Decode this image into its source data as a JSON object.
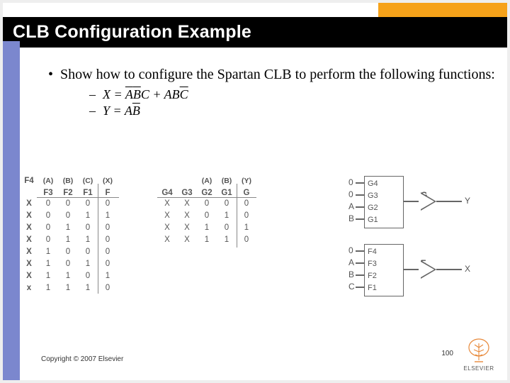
{
  "title": "CLB Configuration Example",
  "bullet_text": "Show how to configure the Spartan CLB to perform the following functions:",
  "equations": {
    "x_lhs": "X",
    "x_eq": " = ",
    "x_t1a": "A",
    "x_t1b": "B",
    "x_t1c": "C",
    "x_plus": " + ",
    "x_t2a": "A",
    "x_t2b": "B",
    "x_t2c": "C",
    "y_lhs": "Y",
    "y_eq": " = ",
    "y_a": "A",
    "y_b": "B"
  },
  "tableF": {
    "name": "F4",
    "paren": [
      "(A)",
      "(B)",
      "(C)",
      "(X)"
    ],
    "cols": [
      "F3",
      "F2",
      "F1",
      "F"
    ],
    "rows": [
      [
        "X",
        "0",
        "0",
        "0",
        "0"
      ],
      [
        "X",
        "0",
        "0",
        "1",
        "1"
      ],
      [
        "X",
        "0",
        "1",
        "0",
        "0"
      ],
      [
        "X",
        "0",
        "1",
        "1",
        "0"
      ],
      [
        "X",
        "1",
        "0",
        "0",
        "0"
      ],
      [
        "X",
        "1",
        "0",
        "1",
        "0"
      ],
      [
        "X",
        "1",
        "1",
        "0",
        "1"
      ],
      [
        "x",
        "1",
        "1",
        "1",
        "0"
      ]
    ]
  },
  "tableG": {
    "paren": [
      "(A)",
      "(B)",
      "(Y)"
    ],
    "cols": [
      "G4",
      "G3",
      "G2",
      "G1",
      "G"
    ],
    "rows": [
      [
        "X",
        "X",
        "0",
        "0",
        "0"
      ],
      [
        "X",
        "X",
        "0",
        "1",
        "0"
      ],
      [
        "X",
        "X",
        "1",
        "0",
        "1"
      ],
      [
        "X",
        "X",
        "1",
        "1",
        "0"
      ]
    ]
  },
  "lutG": {
    "inputs": [
      "0",
      "0",
      "A",
      "B"
    ],
    "pins": [
      "G4",
      "G3",
      "G2",
      "G1"
    ],
    "outbuf": "G",
    "out": "Y"
  },
  "lutF": {
    "inputs": [
      "0",
      "A",
      "B",
      "C"
    ],
    "pins": [
      "F4",
      "F3",
      "F2",
      "F1"
    ],
    "outbuf": "F",
    "out": "X"
  },
  "copyright": "Copyright © 2007 Elsevier",
  "pagenum": "100",
  "brand": "ELSEVIER"
}
